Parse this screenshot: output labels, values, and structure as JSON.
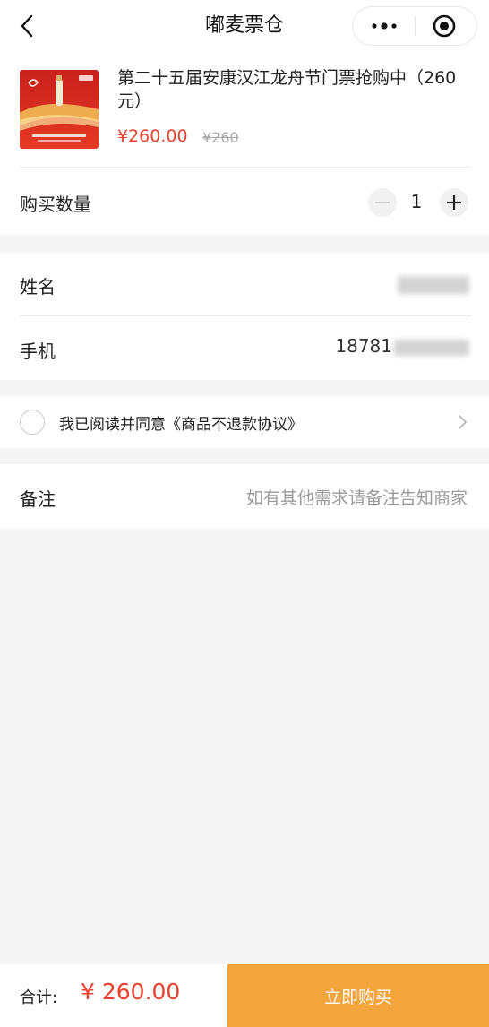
{
  "nav": {
    "title": "嘟麦票仓",
    "back_icon": "chevron-left-icon",
    "more_icon": "more-dots-icon",
    "close_icon": "target-circle-icon"
  },
  "product": {
    "title": "第二十五届安康汉江龙舟节门票抢购中（260元）",
    "price": "¥260.00",
    "original_price": "¥260",
    "thumbnail_icon": "product-poster-image"
  },
  "quantity": {
    "label": "购买数量",
    "value": "1",
    "minus_icon": "minus-icon",
    "plus_icon": "plus-icon"
  },
  "form": {
    "name_label": "姓名",
    "phone_label": "手机",
    "phone_value_visible": "18781"
  },
  "agreement": {
    "text": "我已阅读并同意《商品不退款协议》",
    "checked": false
  },
  "remark": {
    "label": "备注",
    "placeholder": "如有其他需求请备注告知商家"
  },
  "footer": {
    "total_label": "合计:",
    "total_value": "¥ 260.00",
    "buy_label": "立即购买"
  },
  "colors": {
    "price_red": "#e8412d",
    "buy_orange": "#f3a43b",
    "background": "#f5f5f5"
  }
}
